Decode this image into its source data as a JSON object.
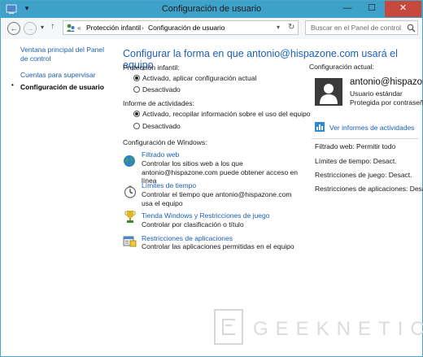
{
  "window": {
    "title": "Configuración de usuario",
    "minimize": "—",
    "maximize": "☐",
    "close": "✕"
  },
  "nav": {
    "back": "←",
    "forward": "→",
    "dropdown": "▾",
    "up": "↑",
    "breadcrumb_sep": "«",
    "crumbs": [
      "Protección infantil",
      "Configuración de usuario"
    ],
    "crumb_arrow": "›",
    "addr_dropdown": "▾",
    "refresh": "↻",
    "search_placeholder": "Buscar en el Panel de control",
    "search_icon": "search-icon"
  },
  "sidebar": {
    "items": [
      "Ventana principal del Panel de control",
      "Cuentas para supervisar",
      "Configuración de usuario"
    ]
  },
  "main": {
    "title": "Configurar la forma en que antonio@hispazone.com usará el equipo",
    "parental": {
      "label": "Protección infantil:",
      "options": [
        "Activado, aplicar configuración actual",
        "Desactivado"
      ],
      "selected": 0
    },
    "activity": {
      "label": "Informe de actividades:",
      "options": [
        "Activado, recopilar información sobre el uso del equipo",
        "Desactivado"
      ],
      "selected": 0
    },
    "windows_settings_label": "Configuración de Windows:",
    "settings": [
      {
        "title": "Filtrado web",
        "desc": "Controlar los sitios web a los que antonio@hispazone.com puede obtener acceso en línea",
        "icon": "globe-icon"
      },
      {
        "title": "Límites de tiempo",
        "desc": "Controlar el tiempo que antonio@hispazone.com usa el equipo",
        "icon": "clock-icon"
      },
      {
        "title": "Tienda Windows y Restricciones de juego",
        "desc": "Controlar por clasificación o título",
        "icon": "trophy-icon"
      },
      {
        "title": "Restricciones de aplicaciones",
        "desc": "Controlar las aplicaciones permitidas en el equipo",
        "icon": "apps-icon"
      }
    ]
  },
  "current": {
    "label": "Configuración actual:",
    "user_name": "antonio@hispazone",
    "user_type": "Usuario estándar",
    "user_protect": "Protegida por contraseña",
    "report_link": "Ver informes de actividades",
    "rows": [
      "Filtrado web: Permitir todo",
      "Límites de tiempo: Desact.",
      "Restricciones de juego: Desact.",
      "Restricciones de aplicaciones: Desact."
    ]
  },
  "watermark": "GEEKNETIC",
  "colors": {
    "titlebar": "#3ea1c9",
    "link": "#1b5fb0",
    "heading": "#1d5fb4",
    "close": "#c7493d"
  }
}
